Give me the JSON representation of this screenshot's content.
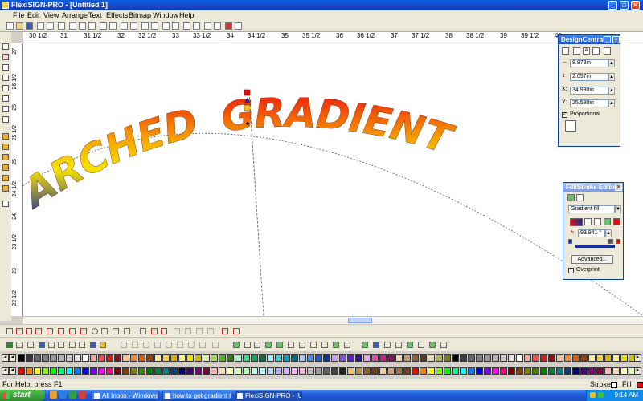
{
  "app": {
    "title": "FlexiSIGN-PRO - [Untitled 1]"
  },
  "menu": [
    "File",
    "Edit",
    "View",
    "Arrange",
    "Text",
    "Effects",
    "Bitmap",
    "Window",
    "Help"
  ],
  "ruler_top": [
    "30 1/2",
    "31",
    "31 1/2",
    "32",
    "32 1/2",
    "33",
    "33 1/2",
    "34",
    "34 1/2",
    "35",
    "35 1/2",
    "36",
    "36 1/2",
    "37",
    "37 1/2",
    "38",
    "38 1/2",
    "39",
    "39 1/2",
    "40"
  ],
  "ruler_left": [
    "27",
    "26 1/2",
    "26",
    "25 1/2",
    "25",
    "24 1/2",
    "24",
    "23 1/2",
    "23",
    "22 1/2"
  ],
  "artwork": {
    "left_word": "ARCHED",
    "right_word": "GRADIENT",
    "gradient": [
      "#f01010",
      "#f5a800",
      "#f7e400",
      "#1a2e9a"
    ]
  },
  "design_central": {
    "title": "DesignCentral",
    "width": "8.873in",
    "height": "2.057in",
    "x_label": "X:",
    "x": "34.930in",
    "y_label": "Y:",
    "y": "25.580in",
    "proportional": "Proportional",
    "proportional_checked": true
  },
  "fill_stroke": {
    "title": "Fill/Stroke Editor",
    "fill_type": "Gradient fill",
    "angle": "93.941 °",
    "advanced": "Advanced...",
    "overprint": "Overprint"
  },
  "status": {
    "help": "For Help, press F1",
    "stroke": "Stroke",
    "fill": "Fill"
  },
  "taskbar": {
    "start": "start",
    "tasks": [
      "All Inbox - Windows Li...",
      "how to get gradient t...",
      "FlexiSIGN-PRO - [Unti..."
    ],
    "clock": "9:14 AM"
  },
  "palette_colors_1": [
    "#000000",
    "#3a3a3a",
    "#666666",
    "#808080",
    "#999999",
    "#b3b3b3",
    "#cccccc",
    "#e6e6e6",
    "#ffffff",
    "#f4a9a9",
    "#f04f4f",
    "#c81e1e",
    "#8c1414",
    "#f4c29a",
    "#f08a3a",
    "#d45f10",
    "#9a4108",
    "#fbe7a1",
    "#f7d23a",
    "#e0b000",
    "#f7f18a",
    "#eee000",
    "#c8c000",
    "#d7f4a1",
    "#a3e04f",
    "#5fb31e",
    "#2f7a14",
    "#a1f4c8",
    "#3ae08a",
    "#14a35f",
    "#0f6e3f",
    "#a1ecf4",
    "#3ad2e0",
    "#14a0b3",
    "#0a6b78",
    "#a1c8f4",
    "#4f8ae0",
    "#1e5fc8",
    "#103a8c",
    "#c8a1f4",
    "#8a4fe0",
    "#5f1ec8",
    "#3a108c",
    "#f4a1e0",
    "#e04fb8",
    "#c81e8a",
    "#8c105f",
    "#f4d4b8",
    "#c89a6e",
    "#8c5f3a",
    "#5a3a1e",
    "#e0e0a1",
    "#b3b34f",
    "#78781e"
  ],
  "palette_colors_2": [
    "#ff0000",
    "#ff8000",
    "#ffff00",
    "#80ff00",
    "#00ff00",
    "#00ff80",
    "#00ffff",
    "#0080ff",
    "#0000ff",
    "#8000ff",
    "#ff00ff",
    "#ff0080",
    "#800000",
    "#804000",
    "#808000",
    "#408000",
    "#008000",
    "#008040",
    "#008080",
    "#004080",
    "#000080",
    "#400080",
    "#800080",
    "#800040",
    "#ffb3b3",
    "#ffd9b3",
    "#ffffb3",
    "#d9ffb3",
    "#b3ffb3",
    "#b3ffd9",
    "#b3ffff",
    "#b3d9ff",
    "#b3b3ff",
    "#d9b3ff",
    "#ffb3ff",
    "#ffb3d9",
    "#c0c0c0",
    "#a0a0a0",
    "#606060",
    "#404040",
    "#202020",
    "#e8c070",
    "#c09040",
    "#906020",
    "#704010",
    "#f0d0a0",
    "#d0a070",
    "#a07040",
    "#704020"
  ]
}
